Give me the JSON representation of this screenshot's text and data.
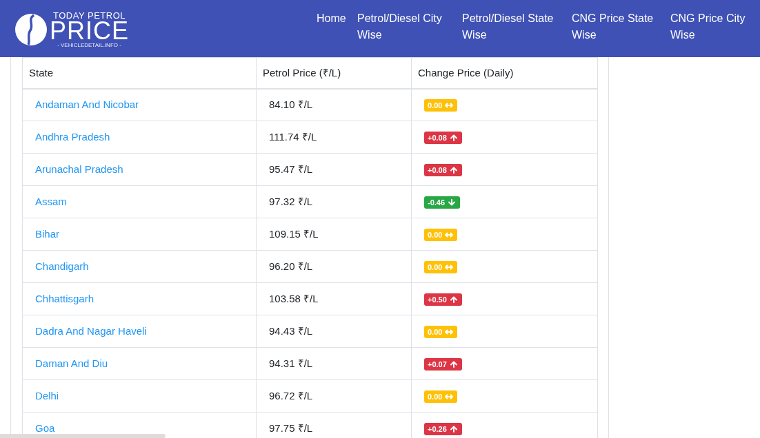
{
  "logo": {
    "top": "TODAY PETROL",
    "main": "PRICE",
    "sub": "- VEHICLEDETAIL.INFO -"
  },
  "nav": [
    "Home",
    "Petrol/Diesel City Wise",
    "Petrol/Diesel State Wise",
    "CNG Price State Wise",
    "CNG Price City Wise"
  ],
  "table": {
    "columns": [
      "State",
      "Petrol Price (₹/L)",
      "Change Price (Daily)"
    ],
    "rows": [
      {
        "state": "Andaman And Nicobar",
        "price": "84.10 ₹/L",
        "change": "0.00",
        "kind": "flat"
      },
      {
        "state": "Andhra Pradesh",
        "price": "111.74 ₹/L",
        "change": "+0.08",
        "kind": "up"
      },
      {
        "state": "Arunachal Pradesh",
        "price": "95.47 ₹/L",
        "change": "+0.08",
        "kind": "up"
      },
      {
        "state": "Assam",
        "price": "97.32 ₹/L",
        "change": "-0.46",
        "kind": "down"
      },
      {
        "state": "Bihar",
        "price": "109.15 ₹/L",
        "change": "0.00",
        "kind": "flat"
      },
      {
        "state": "Chandigarh",
        "price": "96.20 ₹/L",
        "change": "0.00",
        "kind": "flat"
      },
      {
        "state": "Chhattisgarh",
        "price": "103.58 ₹/L",
        "change": "+0.50",
        "kind": "up"
      },
      {
        "state": "Dadra And Nagar Haveli",
        "price": "94.43 ₹/L",
        "change": "0.00",
        "kind": "flat"
      },
      {
        "state": "Daman And Diu",
        "price": "94.31 ₹/L",
        "change": "+0.07",
        "kind": "up"
      },
      {
        "state": "Delhi",
        "price": "96.72 ₹/L",
        "change": "0.00",
        "kind": "flat"
      },
      {
        "state": "Goa",
        "price": "97.75 ₹/L",
        "change": "+0.26",
        "kind": "up"
      }
    ]
  }
}
